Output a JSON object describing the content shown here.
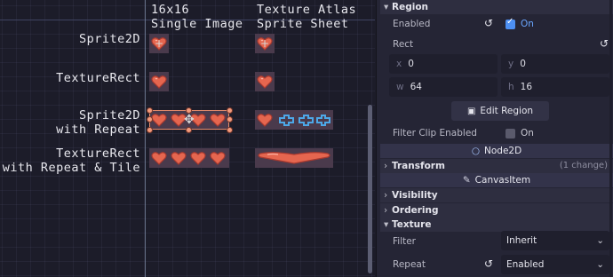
{
  "viewport": {
    "column_headers": [
      "16x16\nSingle Image",
      "Texture Atlas\nSprite Sheet"
    ],
    "row_labels": [
      "Sprite2D",
      "TextureRect",
      "Sprite2D\nwith Repeat",
      "TextureRect\nwith Repeat & Tile"
    ],
    "colors": {
      "heart_fill": "#e5664f",
      "heart_dark": "#a8392f",
      "atlas_blue": "#4da8e8",
      "selection": "#e58b6c"
    }
  },
  "inspector": {
    "region_section": "Region",
    "enabled_label": "Enabled",
    "enabled_value": "On",
    "rect_label": "Rect",
    "rect": {
      "x_axis": "x",
      "x": "0",
      "y_axis": "y",
      "y": "0",
      "w_axis": "w",
      "w": "64",
      "h_axis": "h",
      "h": "16"
    },
    "edit_region_button": "Edit Region",
    "filter_clip_label": "Filter Clip Enabled",
    "filter_clip_value": "On",
    "node2d_label": "Node2D",
    "transform_section": "Transform",
    "transform_change": "(1 change)",
    "canvasitem_label": "CanvasItem",
    "visibility_section": "Visibility",
    "ordering_section": "Ordering",
    "texture_section": "Texture",
    "filter_label": "Filter",
    "filter_value": "Inherit",
    "repeat_label": "Repeat",
    "repeat_value": "Enabled",
    "icons": [
      "revert-icon",
      "link-icon",
      "edit-region-icon",
      "node2d-icon",
      "canvasitem-icon",
      "chevron-down-icon"
    ]
  }
}
